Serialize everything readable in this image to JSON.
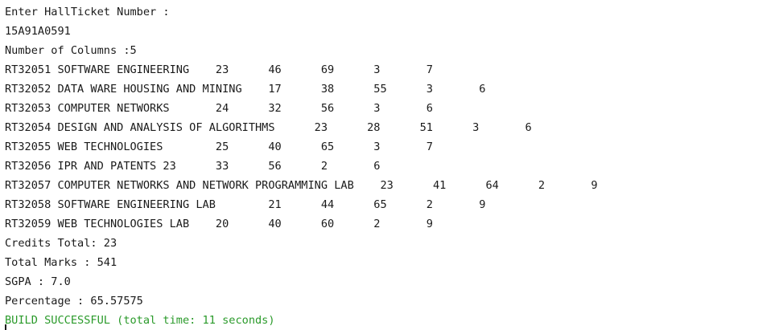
{
  "console": {
    "lines": [
      {
        "text": "Enter HallTicket Number :",
        "type": "prompt"
      },
      {
        "text": "15A91A0591",
        "type": "input"
      },
      {
        "text": "Number of Columns :5",
        "type": "output"
      },
      {
        "text": "RT32051 SOFTWARE ENGINEERING    23      46      69      3       7",
        "type": "output"
      },
      {
        "text": "RT32052 DATA WARE HOUSING AND MINING    17      38      55      3       6",
        "type": "output"
      },
      {
        "text": "RT32053 COMPUTER NETWORKS       24      32      56      3       6",
        "type": "output"
      },
      {
        "text": "RT32054 DESIGN AND ANALYSIS OF ALGORITHMS      23      28      51      3       6",
        "type": "output"
      },
      {
        "text": "RT32055 WEB TECHNOLOGIES        25      40      65      3       7",
        "type": "output"
      },
      {
        "text": "RT32056 IPR AND PATENTS 23      33      56      2       6",
        "type": "output"
      },
      {
        "text": "RT32057 COMPUTER NETWORKS AND NETWORK PROGRAMMING LAB    23      41      64      2       9",
        "type": "output"
      },
      {
        "text": "RT32058 SOFTWARE ENGINEERING LAB        21      44      65      2       9",
        "type": "output"
      },
      {
        "text": "RT32059 WEB TECHNOLOGIES LAB    20      40      60      2       9",
        "type": "output"
      },
      {
        "text": "Credits Total: 23",
        "type": "output"
      },
      {
        "text": "Total Marks : 541",
        "type": "output"
      },
      {
        "text": "SGPA : 7.0",
        "type": "output"
      },
      {
        "text": "Percentage : 65.57575",
        "type": "output"
      },
      {
        "text": "BUILD SUCCESSFUL (total time: 11 seconds)",
        "type": "success"
      }
    ]
  },
  "colors": {
    "text": "#1a1a1a",
    "success": "#2a9a2a",
    "background": "#ffffff"
  }
}
